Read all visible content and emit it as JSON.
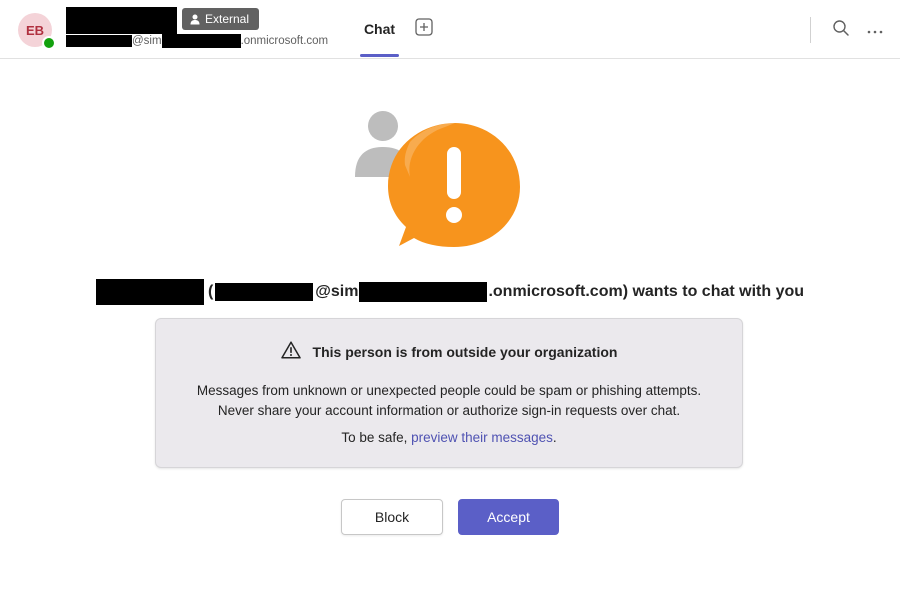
{
  "header": {
    "avatar_initials": "EB",
    "presence_status_color": "#13a10e",
    "external_badge_label": "External",
    "email_middle": "@sim",
    "email_suffix": ".onmicrosoft.com",
    "tabs": [
      {
        "label": "Chat",
        "active": true
      }
    ],
    "icons": [
      "person-icon",
      "add-tab-icon",
      "search-icon",
      "more-options-icon"
    ]
  },
  "illustration": {
    "icons": [
      "person-silhouette-icon",
      "exclamation-bubble-icon"
    ],
    "bubble_color": "#f7941d"
  },
  "request": {
    "open_paren": " (",
    "email_middle": "@sim",
    "email_suffix": ".onmicrosoft.com) wants to chat with you"
  },
  "warning": {
    "icon": "warning-triangle-icon",
    "title": "This person is from outside your organization",
    "line1": "Messages from unknown or unexpected people could be spam or phishing attempts.",
    "line2": "Never share your account information or authorize sign-in requests over chat.",
    "safe_prefix": "To be safe, ",
    "safe_link": "preview their messages",
    "safe_suffix": "."
  },
  "actions": {
    "block_label": "Block",
    "accept_label": "Accept",
    "accent_color": "#5b5fc7"
  }
}
